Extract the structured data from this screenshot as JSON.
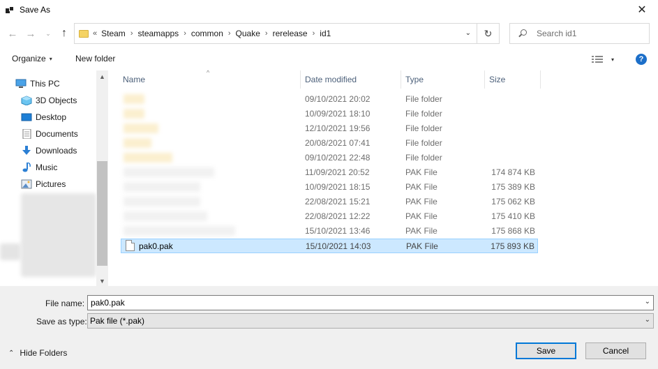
{
  "window": {
    "title": "Save As",
    "close_glyph": "✕"
  },
  "navigation": {
    "back_glyph": "←",
    "forward_glyph": "→",
    "recent_glyph": "⌄",
    "up_glyph": "↑",
    "breadcrumb_lead": "«",
    "breadcrumb": [
      "Steam",
      "steamapps",
      "common",
      "Quake",
      "rerelease",
      "id1"
    ],
    "breadcrumb_separator": "›",
    "refresh_glyph": "↻",
    "search_placeholder": "Search id1"
  },
  "toolbar": {
    "organize_label": "Organize",
    "new_folder_label": "New folder",
    "help_label": "?",
    "caret_glyph": "▾"
  },
  "sidebar": {
    "items": [
      {
        "label": "This PC",
        "icon": "this-pc-icon"
      },
      {
        "label": "3D Objects",
        "icon": "3d-objects-icon"
      },
      {
        "label": "Desktop",
        "icon": "desktop-icon"
      },
      {
        "label": "Documents",
        "icon": "documents-icon"
      },
      {
        "label": "Downloads",
        "icon": "downloads-icon"
      },
      {
        "label": "Music",
        "icon": "music-icon"
      },
      {
        "label": "Pictures",
        "icon": "pictures-icon"
      }
    ]
  },
  "file_list": {
    "columns": {
      "name": "Name",
      "date": "Date modified",
      "type": "Type",
      "size": "Size"
    },
    "sort_glyph": "^",
    "rows": [
      {
        "name": "",
        "date": "09/10/2021 20:02",
        "type": "File folder",
        "size": "",
        "kind": "folder"
      },
      {
        "name": "",
        "date": "10/09/2021 18:10",
        "type": "File folder",
        "size": "",
        "kind": "folder"
      },
      {
        "name": "",
        "date": "12/10/2021 19:56",
        "type": "File folder",
        "size": "",
        "kind": "folder"
      },
      {
        "name": "",
        "date": "20/08/2021 07:41",
        "type": "File folder",
        "size": "",
        "kind": "folder"
      },
      {
        "name": "",
        "date": "09/10/2021 22:48",
        "type": "File folder",
        "size": "",
        "kind": "folder"
      },
      {
        "name": "",
        "date": "11/09/2021 20:52",
        "type": "PAK File",
        "size": "174 874 KB",
        "kind": "file"
      },
      {
        "name": "",
        "date": "10/09/2021 18:15",
        "type": "PAK File",
        "size": "175 389 KB",
        "kind": "file"
      },
      {
        "name": "",
        "date": "22/08/2021 15:21",
        "type": "PAK File",
        "size": "175 062 KB",
        "kind": "file"
      },
      {
        "name": "",
        "date": "22/08/2021 12:22",
        "type": "PAK File",
        "size": "175 410 KB",
        "kind": "file"
      },
      {
        "name": "",
        "date": "15/10/2021 13:46",
        "type": "PAK File",
        "size": "175 868 KB",
        "kind": "file"
      },
      {
        "name": "pak0.pak",
        "date": "15/10/2021 14:03",
        "type": "PAK File",
        "size": "175 893 KB",
        "kind": "file",
        "selected": true
      }
    ]
  },
  "save_form": {
    "file_name_label": "File name:",
    "file_name_value": "pak0.pak",
    "save_as_type_label": "Save as type:",
    "save_as_type_value": "Pak file (*.pak)",
    "dropdown_glyph": "⌄"
  },
  "footer": {
    "hide_folders_label": "Hide Folders",
    "hide_folders_glyph": "⌃",
    "save_label": "Save",
    "cancel_label": "Cancel"
  },
  "colors": {
    "accent": "#0078d7",
    "selection_bg": "#cce8ff",
    "selection_border": "#99d1ff",
    "header_text": "#4c607a",
    "help_icon": "#1c6fc9"
  }
}
